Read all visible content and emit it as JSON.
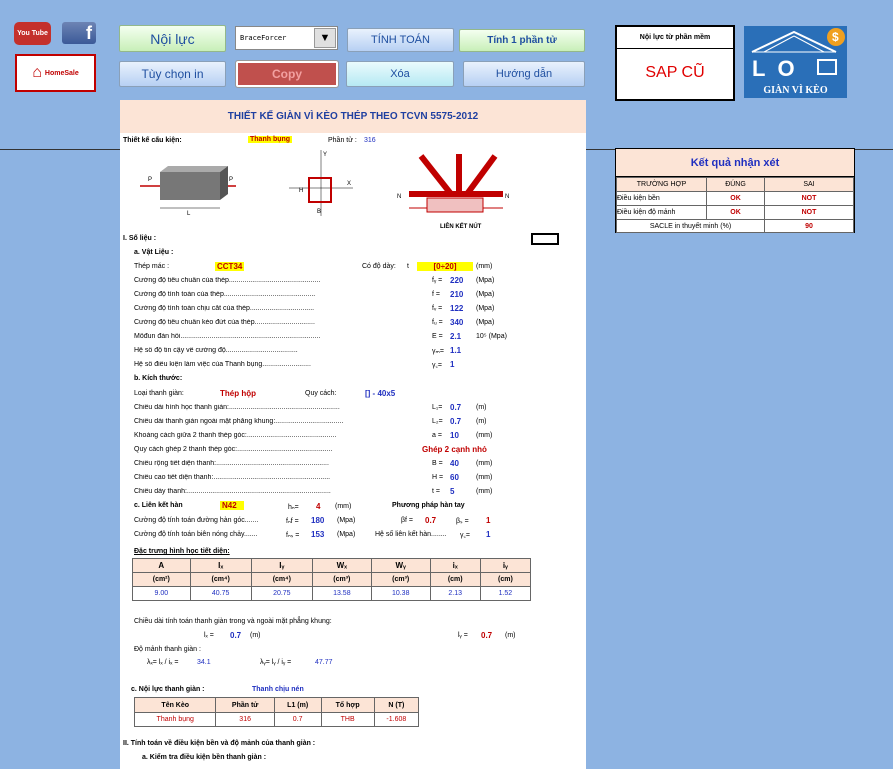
{
  "toolbar": {
    "youtube_label": "You Tube",
    "facebook_label": "f",
    "homesale_label": "HomeSale",
    "noi_luc": "Nội lực",
    "dropdown_value": "BraceForcer",
    "tinh_toan": "TÍNH TOÁN",
    "tinh_1_phan_tu": "Tính 1 phần tử",
    "tuy_chon_in": "Tùy chọn in",
    "copy": "Copy",
    "xoa": "Xóa",
    "huong_dan": "Hướng dẫn"
  },
  "software_box": {
    "header": "Nội lực từ phần mềm",
    "value": "SAP CŨ"
  },
  "logo": {
    "text": "GIÀN VÌ KÈO",
    "letters": "LO"
  },
  "result_panel": {
    "title": "Kết quả nhận xét",
    "headers": [
      "TRƯỜNG HỢP",
      "ĐÚNG",
      "SAI"
    ],
    "rows": [
      {
        "label": "Điều kiện bền",
        "dung": "OK",
        "sai": "NOT"
      },
      {
        "label": "Điều kiện độ mảnh",
        "dung": "OK",
        "sai": "NOT"
      }
    ],
    "sacle_label": "SACLE in thuyết minh (%)",
    "sacle_value": "90"
  },
  "sheet": {
    "title": "THIẾT KẾ GIÀN VÌ KÈO THÉP THEO TCVN 5575-2012",
    "tk_label": "Thiết kế cấu kiện:",
    "tk_value": "Thanh bụng",
    "phan_tu_label": "Phần tử :",
    "phan_tu_value": "316",
    "diagram_label": "LIÊN KẾT NÚT",
    "sec1": "I. Số liệu :",
    "a_vatlieu": "a. Vật Liệu :",
    "thep_mac_label": "Thép mác :",
    "thep_mac_value": "CCT34",
    "do_day_label": "Có độ dày:",
    "do_day_t": "t",
    "do_day_value": "[0÷20]",
    "do_day_unit": "(mm)",
    "material_rows": [
      {
        "label": "Cường độ tiêu chuẩn của thép...............................................",
        "sym": "fᵧ =",
        "val": "220",
        "unit": "(Mpa)"
      },
      {
        "label": "Cường độ tính toán của thép...............................................",
        "sym": "f =",
        "val": "210",
        "unit": "(Mpa)"
      },
      {
        "label": "Cường độ tính toán chịu cắt của thép.................................",
        "sym": "fᵥ =",
        "val": "122",
        "unit": "(Mpa)"
      },
      {
        "label": "Cường độ tiêu chuẩn kéo đứt của thép...............................",
        "sym": "fᵤ =",
        "val": "340",
        "unit": "(Mpa)"
      },
      {
        "label": "Môđun đàn hồi........................................................................",
        "sym": "E =",
        "val": "2.1",
        "unit": "10⁵ (Mpa)"
      },
      {
        "label": "Hệ số độ tin cậy về cường độ.....................................",
        "sym": "γₘ=",
        "val": "1.1",
        "unit": ""
      },
      {
        "label": "Hệ số điều kiện làm việc của Thanh bụng.........................",
        "sym": "γ꜀=",
        "val": "1",
        "unit": ""
      }
    ],
    "b_kichthuoc": "b. Kích thước:",
    "loai_label": "Loại thanh giàn:",
    "loai_value": "Thép hộp",
    "quy_cach_label": "Quy cách:",
    "quy_cach_value": "[] - 40x5",
    "dim_rows": [
      {
        "label": "Chiều dài hình học thanh giàn:.........................................................",
        "sym": "L₁=",
        "val": "0.7",
        "unit": "(m)"
      },
      {
        "label": "Chiều dài thanh giàn ngoài mặt phẳng khung:...................................",
        "sym": "L₂=",
        "val": "0.7",
        "unit": "(m)"
      },
      {
        "label": "Khoảng cách giữa 2 thanh thép góc:..............................................",
        "sym": "a =",
        "val": "10",
        "unit": "(mm)"
      },
      {
        "label": "Quy cách ghép 2 thanh thép góc:.................................................",
        "sym": "",
        "val": "Ghép 2 cạnh nhỏ",
        "unit": ""
      },
      {
        "label": "Chiều rộng tiết diện thanh:..........................................................",
        "sym": "B =",
        "val": "40",
        "unit": "(mm)"
      },
      {
        "label": "Chiều cao tiết diện thanh:............................................................",
        "sym": "H =",
        "val": "60",
        "unit": "(mm)"
      },
      {
        "label": "Chiều dày thanh:..........................................................................",
        "sym": "t =",
        "val": "5",
        "unit": "(mm)"
      }
    ],
    "c_lienket": "c. Liên kết hàn",
    "que_han": "N42",
    "hf_label": "hₙ=",
    "hf_value": "4",
    "hf_unit": "(mm)",
    "phuong_phap": "Phương pháp hàn tay",
    "fwf_label": "Cường độ tính toán đường hàn góc.......",
    "fwf_sym": "fₙf =",
    "fwf_value": "180",
    "fwf_unit": "(Mpa)",
    "bf_sym": "βf =",
    "bf_value": "0.7",
    "bs_sym": "βₛ =",
    "bs_value": "1",
    "fws_label": "Cường độ tính toán biên nóng chảy.......",
    "fws_sym": "fₙₛ =",
    "fws_value": "153",
    "fws_unit": "(Mpa)",
    "hs_lk_label": "Hệ số liên kết hàn........",
    "gc_sym": "γ꜀=",
    "gc_value": "1",
    "dac_trung": "Đặc trưng hình học tiết diện:",
    "geo_headers": [
      "A",
      "Iₓ",
      "Iᵧ",
      "Wₓ",
      "Wᵧ",
      "iₓ",
      "iᵧ"
    ],
    "geo_units": [
      "(cm²)",
      "(cm⁴)",
      "(cm⁴)",
      "(cm³)",
      "(cm³)",
      "(cm)",
      "(cm)"
    ],
    "geo_values": [
      "9.00",
      "40.75",
      "20.75",
      "13.58",
      "10.38",
      "2.13",
      "1.52"
    ],
    "chieu_dai_tt": "Chiều dài tính toán thanh giàn trong và ngoài mặt phẳng khung:",
    "lx_sym": "lₓ =",
    "lx_value": "0.7",
    "lx_unit": "(m)",
    "ly_sym": "lᵧ =",
    "ly_value": "0.7",
    "ly_unit": "(m)",
    "do_manh": "Độ mảnh thanh giàn :",
    "lamx_sym": "λₓ= lₓ / iₓ =",
    "lamx_value": "34.1",
    "lamy_sym": "λᵧ= lᵧ / iᵧ =",
    "lamy_value": "47.77",
    "c_noiluc": "c. Nội lực thanh giàn :",
    "thanh_chiu": "Thanh chịu nén",
    "force_headers": [
      "Tên Kèo",
      "Phần tử",
      "L1 (m)",
      "Tổ hợp",
      "N (T)"
    ],
    "force_values": [
      "Thanh bụng",
      "316",
      "0.7",
      "THB",
      "-1.608"
    ],
    "sec2": "II.  Tính toán về điều kiện bền và độ mảnh của thanh giàn :",
    "sec2a": "a.   Kiểm tra điều kiện bền thanh giàn :"
  }
}
